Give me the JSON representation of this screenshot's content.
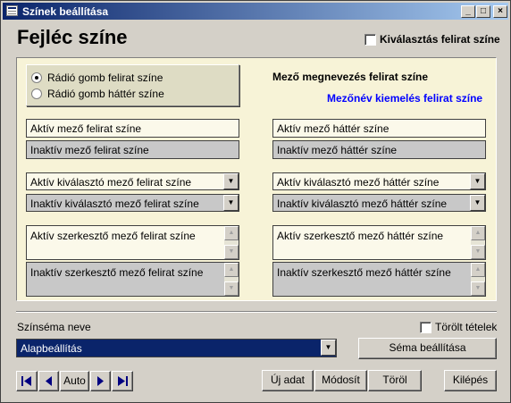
{
  "window": {
    "title": "Színek beállítása"
  },
  "titlebar_buttons": [
    "_",
    "□",
    "×"
  ],
  "page": {
    "title": "Fejléc színe"
  },
  "select_label_checkbox": {
    "label": "Kiválasztás felirat színe",
    "checked": false
  },
  "radios": [
    {
      "label": "Rádió gomb felirat színe",
      "selected": true
    },
    {
      "label": "Rádió gomb háttér színe",
      "selected": false
    }
  ],
  "field_name_label": "Mező megnevezés felirat színe",
  "field_name_highlight_label": "Mezőnév kiemelés felirat színe",
  "fields": {
    "active_text": "Aktív mező felirat színe",
    "inactive_text": "Inaktív mező felirat színe",
    "active_bg": "Aktív mező háttér színe",
    "inactive_bg": "Inaktív mező háttér színe"
  },
  "combos": {
    "active_sel_text": "Aktív kiválasztó mező felirat színe",
    "inactive_sel_text": "Inaktív kiválasztó mező felirat színe",
    "active_sel_bg": "Aktív kiválasztó mező háttér színe",
    "inactive_sel_bg": "Inaktív kiválasztó mező háttér színe"
  },
  "memos": {
    "active_edit_text": "Aktív szerkesztő mező felirat színe",
    "inactive_edit_text": "Inaktív szerkesztő mező felirat színe",
    "active_edit_bg": "Aktív szerkesztő mező háttér színe",
    "inactive_edit_bg": "Inaktív szerkesztő mező háttér színe"
  },
  "scheme": {
    "label": "Színséma neve",
    "value": "Alapbeállítás",
    "set_button": "Séma beállítása"
  },
  "deleted_checkbox": {
    "label": "Törölt tételek",
    "checked": false
  },
  "nav": {
    "auto": "Auto"
  },
  "actions": {
    "new": "Új adat",
    "modify": "Módosít",
    "delete": "Töröl",
    "exit": "Kilépés"
  },
  "colors": {
    "title_bar": "#0a246a",
    "panel_bg": "#f7f3d7",
    "highlight_text": "#0000ff",
    "combo_selected_bg": "#0a246a"
  }
}
